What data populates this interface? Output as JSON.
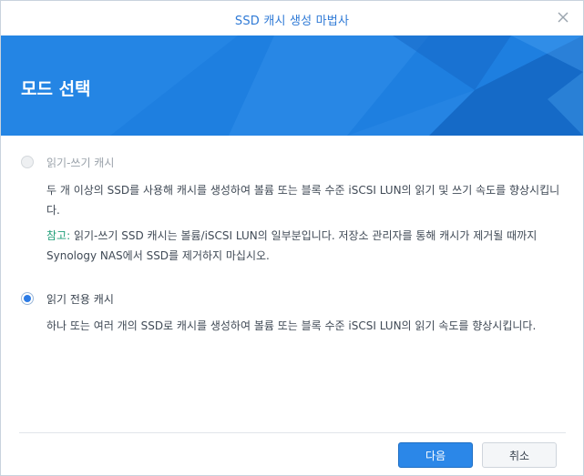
{
  "window": {
    "title": "SSD 캐시 생성 마법사",
    "close_icon": "close-icon"
  },
  "banner": {
    "title": "모드 선택",
    "color": "#1e7fe0"
  },
  "options": [
    {
      "label": "읽기-쓰기 캐시",
      "selected": false,
      "disabled": true,
      "description": "두 개 이상의 SSD를 사용해 캐시를 생성하여 볼륨 또는 블록 수준 iSCSI LUN의 읽기 및 쓰기 속도를 향상시킵니다.",
      "note_label": "참고:",
      "note_text": " 읽기-쓰기 SSD 캐시는 볼륨/iSCSI LUN의 일부분입니다. 저장소 관리자를 통해 캐시가 제거될 때까지 Synology NAS에서 SSD를 제거하지 마십시오."
    },
    {
      "label": "읽기 전용 캐시",
      "selected": true,
      "disabled": false,
      "description": "하나 또는 여러 개의 SSD로 캐시를 생성하여 볼륨 또는 블록 수준 iSCSI LUN의 읽기 속도를 향상시킵니다."
    }
  ],
  "footer": {
    "next_label": "다음",
    "cancel_label": "취소"
  },
  "colors": {
    "accent": "#2c7be5",
    "note": "#1f9e78"
  }
}
